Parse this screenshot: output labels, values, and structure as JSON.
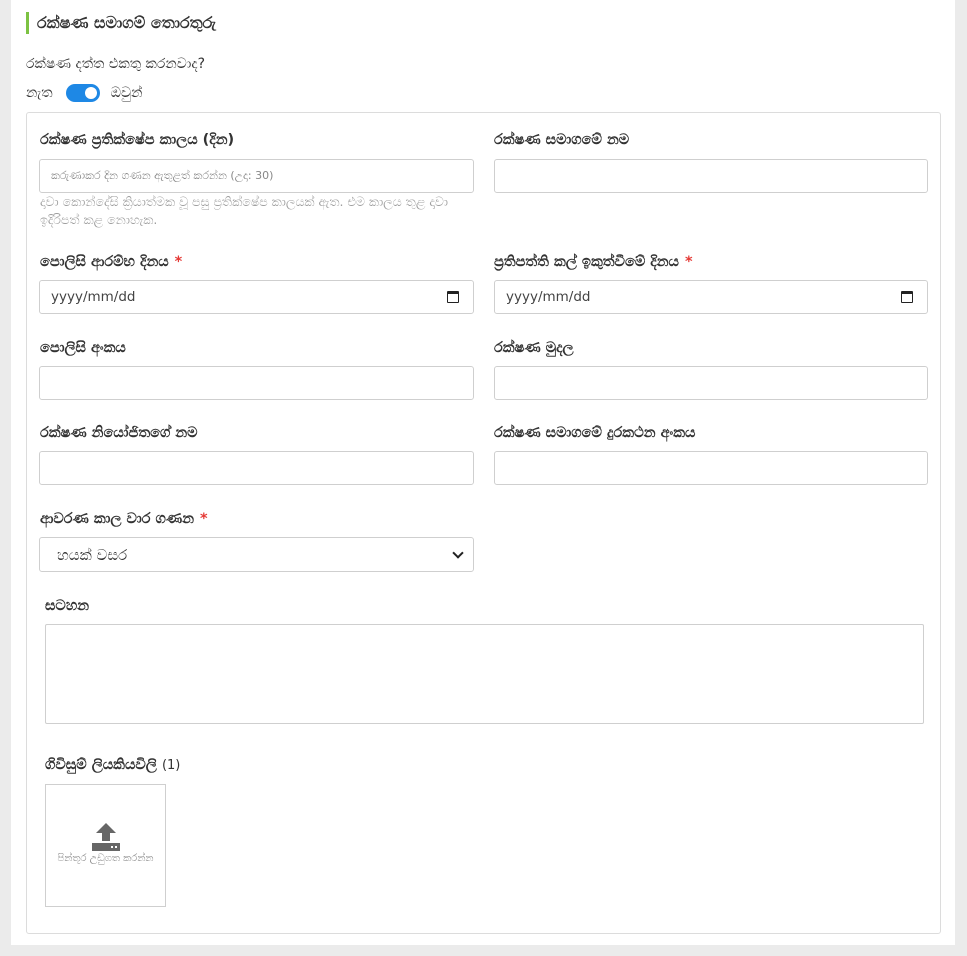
{
  "section": {
    "title": "රක්ෂණ සමාගම් තොරතුරු"
  },
  "collect": {
    "question": "රක්ෂණ දත්ත එකතු කරනවාද?",
    "no_label": "නැත",
    "yes_label": "ඔවුන්",
    "enabled": true
  },
  "form": {
    "rejection_period": {
      "label": "රක්ෂණ ප්‍රතික්ෂේප කාලය (දින)",
      "placeholder": "කරුණාකර දින ගණන ඇතුළත් කරන්න (උදා: 30)",
      "help": "දාවා කොන්දේසි ක්‍රියාත්මක වූ පසු ප්‍රතික්ෂේප කාලයක් ඇත. එම කාලය තුළ දාවා ඉදිරිපත් කළ නොහැක."
    },
    "company_name": {
      "label": "රක්ෂණ සමාගමේ නම",
      "value": ""
    },
    "policy_start": {
      "label": "පොලිසි ආරම්භ දිනය",
      "required": "*",
      "placeholder": "yyyy/mm/dd"
    },
    "policy_expiry": {
      "label": "ප්‍රතිපත්ති කල් ඉකුත්වීමේ දිනය",
      "required": "*",
      "placeholder": "yyyy/mm/dd"
    },
    "policy_number": {
      "label": "පොලිසි අංකය",
      "value": ""
    },
    "amount": {
      "label": "රක්ෂණ මුදල",
      "value": ""
    },
    "agent_name": {
      "label": "රක්ෂණ නියෝජිතගේ නම",
      "value": ""
    },
    "company_phone": {
      "label": "රක්ෂණ සමාගමේ දුරකථන අංකය",
      "value": ""
    },
    "coverage_count": {
      "label": "ආවරණ කාල වාර ගණන",
      "required": "*",
      "selected": "හයක් වසර"
    },
    "notes": {
      "label": "සටහන",
      "value": ""
    },
    "documents": {
      "label": "ගිවිසුම් ලියකියවිලි",
      "count": "(1)",
      "upload_text": "පින්තූර උඩුගත කරන්න",
      "icon": "upload-icon"
    }
  }
}
